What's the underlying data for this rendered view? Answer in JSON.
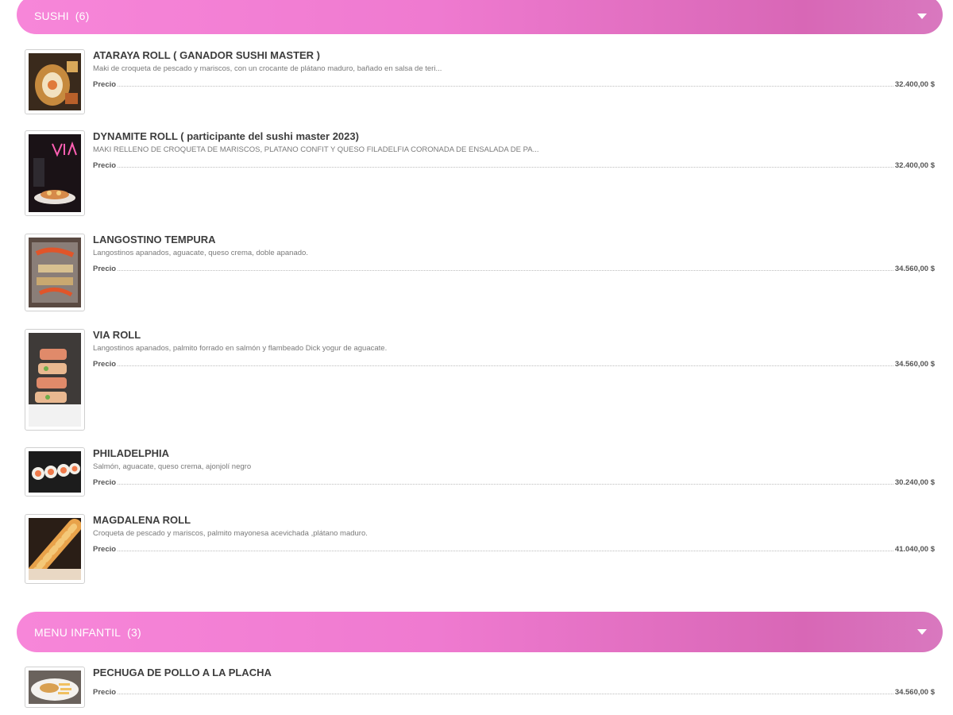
{
  "categories": [
    {
      "title": "SUSHI",
      "count": "(6)",
      "items": [
        {
          "title": "ATARAYA ROLL ( GANADOR SUSHI MASTER )",
          "description": "Maki de croqueta de pescado y mariscos, con un crocante de plátano maduro, bañado en salsa de teri...",
          "price_label": "Precio",
          "price": "32.400,00 $"
        },
        {
          "title": "DYNAMITE ROLL ( participante del sushi master 2023)",
          "description": "MAKI RELLENO DE CROQUETA DE MARISCOS, PLATANO CONFIT Y QUESO FILADELFIA CORONADA DE ENSALADA DE PA...",
          "price_label": "Precio",
          "price": "32.400,00 $"
        },
        {
          "title": "LANGOSTINO TEMPURA",
          "description": "Langostinos apanados, aguacate, queso crema, doble apanado.",
          "price_label": "Precio",
          "price": "34.560,00 $"
        },
        {
          "title": "VIA ROLL",
          "description": "Langostinos apanados, palmito forrado en salmón y flambeado Dick yogur de aguacate.",
          "price_label": "Precio",
          "price": "34.560,00 $"
        },
        {
          "title": "PHILADELPHIA",
          "description": "Salmón, aguacate, queso crema, ajonjolí negro",
          "price_label": "Precio",
          "price": "30.240,00 $"
        },
        {
          "title": "MAGDALENA ROLL",
          "description": "Croqueta de pescado y mariscos, palmito mayonesa acevichada ,plátano maduro.",
          "price_label": "Precio",
          "price": "41.040,00 $"
        }
      ]
    },
    {
      "title": "MENU INFANTIL",
      "count": "(3)",
      "items": [
        {
          "title": "PECHUGA DE POLLO A LA PLACHA",
          "description": "",
          "price_label": "Precio",
          "price": "34.560,00 $"
        }
      ]
    }
  ],
  "icons": {
    "expand": "chevron-down-icon"
  },
  "colors": {
    "category_gradient_start": "#f786d9",
    "category_gradient_end": "#d867b6",
    "category_text": "#ffffff"
  }
}
